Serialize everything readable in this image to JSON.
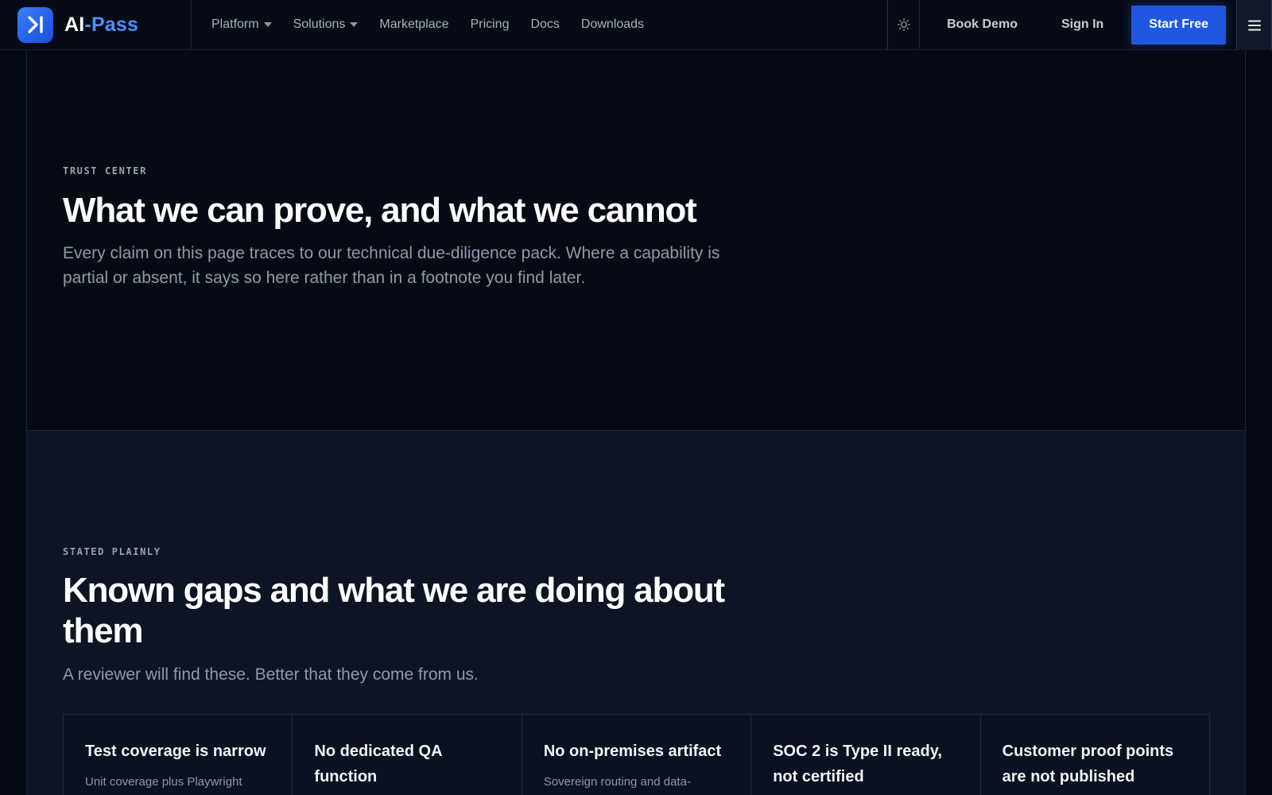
{
  "brand": {
    "name_main": "AI",
    "name_sep": "-",
    "name_accent": "Pass"
  },
  "nav": {
    "items": [
      {
        "label": "Platform",
        "has_dropdown": true
      },
      {
        "label": "Solutions",
        "has_dropdown": true
      },
      {
        "label": "Marketplace",
        "has_dropdown": false
      },
      {
        "label": "Pricing",
        "has_dropdown": false
      },
      {
        "label": "Docs",
        "has_dropdown": false
      },
      {
        "label": "Downloads",
        "has_dropdown": false
      }
    ]
  },
  "header": {
    "theme_icon": "sun-icon",
    "book_demo": "Book Demo",
    "sign_in": "Sign In",
    "start_free": "Start Free",
    "menu_icon": "hamburger-menu-icon"
  },
  "hero": {
    "eyebrow": "TRUST CENTER",
    "title": "What we can prove, and what we cannot",
    "lead": "Every claim on this page traces to our technical due-diligence pack. Where a capability is partial or absent, it says so here rather than in a footnote you find later."
  },
  "gaps": {
    "eyebrow": "STATED PLAINLY",
    "title": "Known gaps and what we are doing about them",
    "lead": "A reviewer will find these. Better that they come from us.",
    "cards": [
      {
        "title": "Test coverage is narrow",
        "body": "Unit coverage plus Playwright"
      },
      {
        "title": "No dedicated QA function",
        "body": ""
      },
      {
        "title": "No on-premises artifact",
        "body": "Sovereign routing and data-"
      },
      {
        "title": "SOC 2 is Type II ready, not certified",
        "body": ""
      },
      {
        "title": "Customer proof points are not published",
        "body": ""
      }
    ]
  },
  "colors": {
    "background": "#060a14",
    "section_alt": "#0d1424",
    "accent": "#1f57e0",
    "brand_accent": "#4f8ff7"
  }
}
